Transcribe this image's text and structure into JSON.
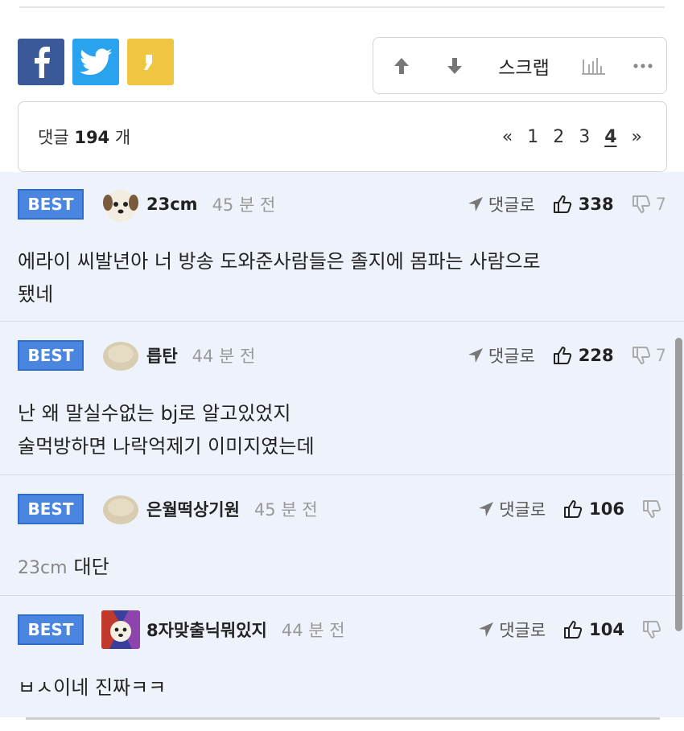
{
  "share": {
    "facebook_icon": "facebook-icon",
    "twitter_icon": "twitter-icon",
    "kakaostory_icon": "kakaostory-icon"
  },
  "toolbar": {
    "scrap_label": "스크랩"
  },
  "comment_bar": {
    "count_prefix": "댓글",
    "count": "194",
    "count_suffix": "개",
    "prev_label": "«",
    "pages": [
      "1",
      "2",
      "3",
      "4"
    ],
    "current_page": "4",
    "next_label": "»"
  },
  "comments": [
    {
      "badge": "BEST",
      "nickname": "23cm",
      "time": "45 분 전",
      "reply_label": "댓글로",
      "likes": "338",
      "dislikes": "7",
      "mention": "",
      "text_lines": [
        "에라이 씨발년아 너 방송 도와준사람들은 졸지에 몸파는 사람으로",
        "됐네"
      ]
    },
    {
      "badge": "BEST",
      "nickname": "릅탄",
      "time": "44 분 전",
      "reply_label": "댓글로",
      "likes": "228",
      "dislikes": "7",
      "mention": "",
      "text_lines": [
        "난 왜 말실수없는 bj로 알고있었지",
        "술먹방하면 나락억제기 이미지였는데"
      ]
    },
    {
      "badge": "BEST",
      "nickname": "은월떡상기원",
      "time": "45 분 전",
      "reply_label": "댓글로",
      "likes": "106",
      "dislikes": "",
      "mention": "23cm",
      "text_lines": [
        "대단"
      ]
    },
    {
      "badge": "BEST",
      "nickname": "8자맞출닉뭐있지",
      "time": "44 분 전",
      "reply_label": "댓글로",
      "likes": "104",
      "dislikes": "",
      "mention": "",
      "text_lines": [
        "ㅂㅅ이네 진짜ㅋㅋ"
      ]
    }
  ],
  "colors": {
    "best_badge": "#4a86e0",
    "comment_bg": "#eef3fb",
    "facebook": "#3b5998",
    "twitter": "#2aa3ef",
    "kakaostory": "#f0c541"
  }
}
